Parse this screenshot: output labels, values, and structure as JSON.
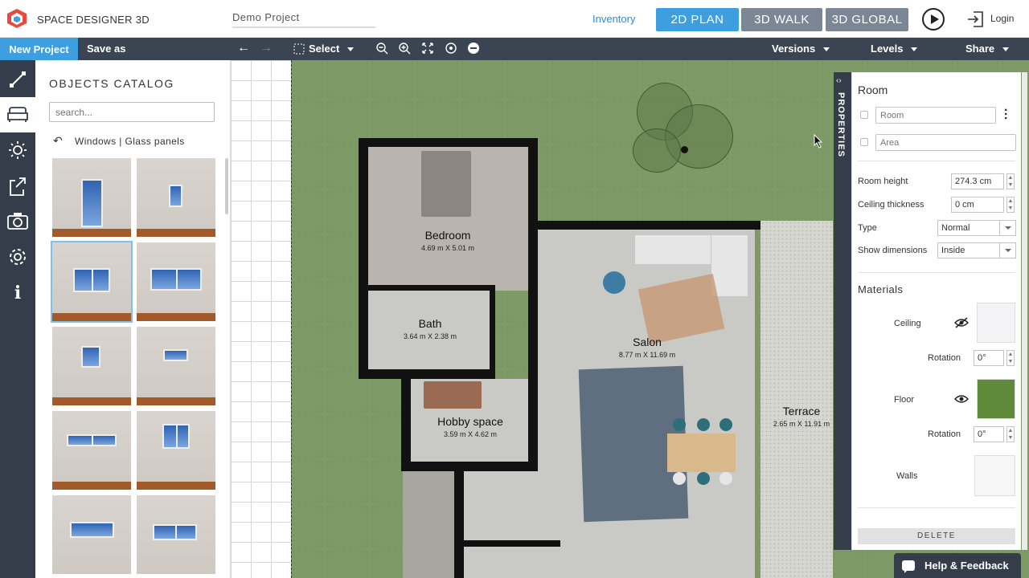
{
  "app": {
    "title": "SPACE DESIGNER 3D",
    "project_name": "Demo Project",
    "brand_color": "#3d9fe0"
  },
  "header": {
    "inventory_label": "Inventory",
    "modes": [
      "2D PLAN",
      "3D WALK",
      "3D GLOBAL"
    ],
    "active_mode": "2D PLAN",
    "login_label": "Login"
  },
  "toolbar": {
    "new_project": "New Project",
    "save_as": "Save as",
    "select_label": "Select",
    "versions_label": "Versions",
    "levels_label": "Levels",
    "share_label": "Share"
  },
  "rail": {
    "icons": [
      "measure-icon",
      "furniture-icon",
      "sun-icon",
      "export-icon",
      "camera-icon",
      "gear-icon",
      "info-icon"
    ],
    "active": "furniture-icon"
  },
  "catalog": {
    "title": "OBJECTS CATALOG",
    "search_placeholder": "search...",
    "breadcrumb": "Windows | Glass panels"
  },
  "plan": {
    "rooms": [
      {
        "name": "Bedroom",
        "dims": "4.69 m X 5.01 m"
      },
      {
        "name": "Bath",
        "dims": "3.64 m X 2.38 m"
      },
      {
        "name": "Hobby space",
        "dims": "3.59 m X 4.62 m"
      },
      {
        "name": "Salon",
        "dims": "8.77 m X 11.69 m"
      },
      {
        "name": "Terrace",
        "dims": "2.65 m X 11.91 m"
      }
    ]
  },
  "properties": {
    "tab_label": "PROPERTIES",
    "title": "Room",
    "name_placeholder": "Room",
    "area_placeholder": "Area",
    "room_height_label": "Room height",
    "room_height_value": "274.3 cm",
    "ceiling_thickness_label": "Ceiling thickness",
    "ceiling_thickness_value": "0 cm",
    "type_label": "Type",
    "type_value": "Normal",
    "show_dimensions_label": "Show dimensions",
    "show_dimensions_value": "Inside",
    "materials_label": "Materials",
    "ceiling_label": "Ceiling",
    "ceiling_rotation_label": "Rotation",
    "ceiling_rotation_value": "0°",
    "floor_label": "Floor",
    "floor_rotation_label": "Rotation",
    "floor_rotation_value": "0°",
    "walls_label": "Walls",
    "delete_label": "DELETE",
    "floor_swatch_color": "#5e8a3a",
    "ceiling_swatch_color": "#f4f4f6"
  },
  "help": {
    "label": "Help & Feedback"
  }
}
